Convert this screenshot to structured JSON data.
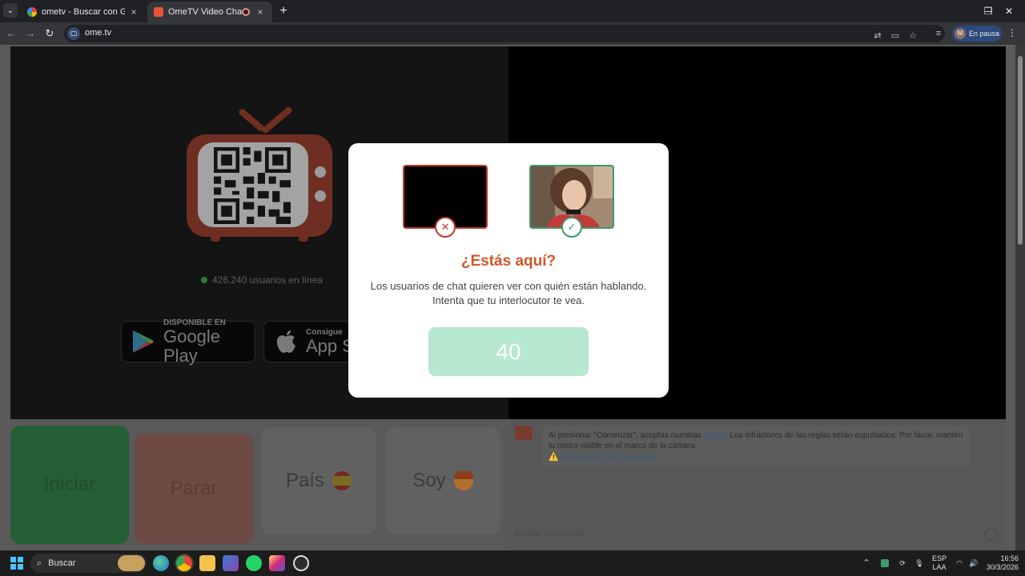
{
  "browser": {
    "tabs": [
      {
        "title": "ometv - Buscar con Google",
        "close": "×"
      },
      {
        "title": "OmeTV Video Chat — Ome",
        "close": "×"
      }
    ],
    "new_tab": "+",
    "tab_menu": "⌄",
    "window": {
      "minimize": "─",
      "restore": "❐",
      "close": "✕"
    },
    "nav": {
      "back": "←",
      "forward": "→",
      "reload": "↻"
    },
    "url": "ome.tv",
    "profile_status": "En pausa",
    "profile_initial": "M",
    "menu": "⋮"
  },
  "page": {
    "online_text": "426.240 usuarios en línea",
    "google_play": {
      "small": "DISPONIBLE EN",
      "big": "Google Play"
    },
    "app_store": {
      "small": "Consigue",
      "big": "App S"
    },
    "buttons": {
      "start": "Iniciar",
      "stop": "Parar",
      "country": "País",
      "gender": "Soy"
    },
    "chat": {
      "notice_pre": "Al presionar \"Comenzar\", aceptas nuestras ",
      "notice_link": "reglas",
      "notice_post": ". Los infractores de las reglas serán expulsados. Por favor, mantén tu rostro visible en el marco de la cámara.",
      "warning_icon": "⚠️",
      "security_link": "Recordatorio de seguridad",
      "input_placeholder": "Escribe un mensaje"
    }
  },
  "modal": {
    "bad_icon": "✕",
    "good_icon": "✓",
    "title": "¿Estás aquí?",
    "line1": "Los usuarios de chat quieren ver con quién están hablando.",
    "line2": "Intenta que tu interlocutor te vea.",
    "countdown": "40"
  },
  "taskbar": {
    "search_label": "Buscar",
    "search_icon": "⌕",
    "lang_top": "ESP",
    "lang_bottom": "LAA",
    "time": "16:56",
    "date": "30/3/2026",
    "tray_up": "⌃"
  },
  "colors": {
    "modal_title": "#d4552b",
    "countdown_bg": "#b6e8cf",
    "bad": "#c0392b",
    "good": "#3d9a6a"
  }
}
